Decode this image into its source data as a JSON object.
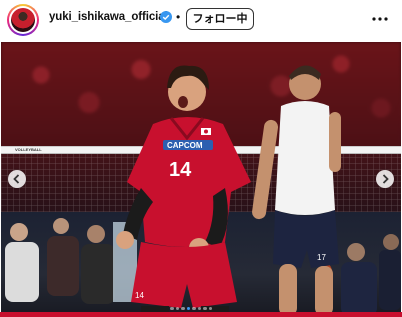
{
  "header": {
    "username": "yuki_ishikawa_official",
    "separator": "•",
    "follow_label": "フォロー中"
  },
  "photo": {
    "net_brand": "VOLLEYBALL",
    "player_number": "14",
    "bench_number": "17",
    "chest_text": "CAPCOM",
    "carousel_index": 4,
    "carousel_total": 8
  },
  "colors": {
    "accent": "#3897f0",
    "jersey_red": "#c8102e"
  }
}
